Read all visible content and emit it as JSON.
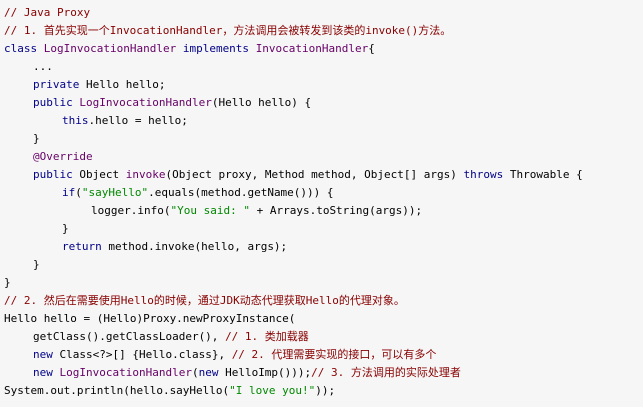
{
  "colors": {
    "background": "#f6f6f6",
    "comment": "#880000",
    "keyword": "#000088",
    "type": "#660066",
    "string": "#008800",
    "annotation": "#660066",
    "plain": "#000000"
  },
  "code": {
    "lines": [
      {
        "indent": 0,
        "tokens": [
          {
            "t": "comment",
            "v": "// Java Proxy"
          }
        ]
      },
      {
        "indent": 0,
        "tokens": [
          {
            "t": "comment",
            "v": "// 1. 首先实现一个InvocationHandler，方法调用会被转发到该类的invoke()方法。"
          }
        ]
      },
      {
        "indent": 0,
        "tokens": [
          {
            "t": "keyword",
            "v": "class"
          },
          {
            "t": "plain",
            "v": " "
          },
          {
            "t": "type",
            "v": "LogInvocationHandler"
          },
          {
            "t": "plain",
            "v": " "
          },
          {
            "t": "keyword",
            "v": "implements"
          },
          {
            "t": "plain",
            "v": " "
          },
          {
            "t": "type",
            "v": "InvocationHandler"
          },
          {
            "t": "plain",
            "v": "{"
          }
        ]
      },
      {
        "indent": 1,
        "tokens": [
          {
            "t": "plain",
            "v": "..."
          }
        ]
      },
      {
        "indent": 1,
        "tokens": [
          {
            "t": "keyword",
            "v": "private"
          },
          {
            "t": "plain",
            "v": " Hello hello;"
          }
        ]
      },
      {
        "indent": 1,
        "tokens": [
          {
            "t": "keyword",
            "v": "public"
          },
          {
            "t": "plain",
            "v": " "
          },
          {
            "t": "type",
            "v": "LogInvocationHandler"
          },
          {
            "t": "plain",
            "v": "(Hello hello) {"
          }
        ]
      },
      {
        "indent": 2,
        "tokens": [
          {
            "t": "keyword",
            "v": "this"
          },
          {
            "t": "plain",
            "v": ".hello = hello;"
          }
        ]
      },
      {
        "indent": 1,
        "tokens": [
          {
            "t": "plain",
            "v": "}"
          }
        ]
      },
      {
        "indent": 1,
        "tokens": [
          {
            "t": "annotation",
            "v": "@Override"
          }
        ]
      },
      {
        "indent": 1,
        "tokens": [
          {
            "t": "keyword",
            "v": "public"
          },
          {
            "t": "plain",
            "v": " Object "
          },
          {
            "t": "type",
            "v": "invoke"
          },
          {
            "t": "plain",
            "v": "(Object proxy, Method method, Object[] args) "
          },
          {
            "t": "keyword",
            "v": "throws"
          },
          {
            "t": "plain",
            "v": " Throwable {"
          }
        ]
      },
      {
        "indent": 2,
        "tokens": [
          {
            "t": "keyword",
            "v": "if"
          },
          {
            "t": "plain",
            "v": "("
          },
          {
            "t": "string",
            "v": "\"sayHello\""
          },
          {
            "t": "plain",
            "v": ".equals(method.getName())) {"
          }
        ]
      },
      {
        "indent": 3,
        "tokens": [
          {
            "t": "plain",
            "v": "logger.info("
          },
          {
            "t": "string",
            "v": "\"You said: \""
          },
          {
            "t": "plain",
            "v": " + Arrays.toString(args));"
          }
        ]
      },
      {
        "indent": 2,
        "tokens": [
          {
            "t": "plain",
            "v": "}"
          }
        ]
      },
      {
        "indent": 2,
        "tokens": [
          {
            "t": "keyword",
            "v": "return"
          },
          {
            "t": "plain",
            "v": " method.invoke(hello, args);"
          }
        ]
      },
      {
        "indent": 1,
        "tokens": [
          {
            "t": "plain",
            "v": "}"
          }
        ]
      },
      {
        "indent": 0,
        "tokens": [
          {
            "t": "plain",
            "v": "}"
          }
        ]
      },
      {
        "indent": 0,
        "tokens": [
          {
            "t": "comment",
            "v": "// 2. 然后在需要使用Hello的时候，通过JDK动态代理获取Hello的代理对象。"
          }
        ]
      },
      {
        "indent": 0,
        "tokens": [
          {
            "t": "plain",
            "v": "Hello hello = (Hello)Proxy.newProxyInstance("
          }
        ]
      },
      {
        "indent": 1,
        "tokens": [
          {
            "t": "plain",
            "v": "getClass().getClassLoader(), "
          },
          {
            "t": "comment",
            "v": "// 1. 类加载器"
          }
        ]
      },
      {
        "indent": 1,
        "tokens": [
          {
            "t": "keyword",
            "v": "new"
          },
          {
            "t": "plain",
            "v": " Class<?>[] {Hello.class}, "
          },
          {
            "t": "comment",
            "v": "// 2. 代理需要实现的接口，可以有多个"
          }
        ]
      },
      {
        "indent": 1,
        "tokens": [
          {
            "t": "keyword",
            "v": "new"
          },
          {
            "t": "plain",
            "v": " "
          },
          {
            "t": "type",
            "v": "LogInvocationHandler"
          },
          {
            "t": "plain",
            "v": "("
          },
          {
            "t": "keyword",
            "v": "new"
          },
          {
            "t": "plain",
            "v": " HelloImp()));"
          },
          {
            "t": "comment",
            "v": "// 3. 方法调用的实际处理者"
          }
        ]
      },
      {
        "indent": 0,
        "tokens": [
          {
            "t": "plain",
            "v": "System.out.println(hello.sayHello("
          },
          {
            "t": "string",
            "v": "\"I love you!\""
          },
          {
            "t": "plain",
            "v": "));"
          }
        ]
      }
    ]
  }
}
